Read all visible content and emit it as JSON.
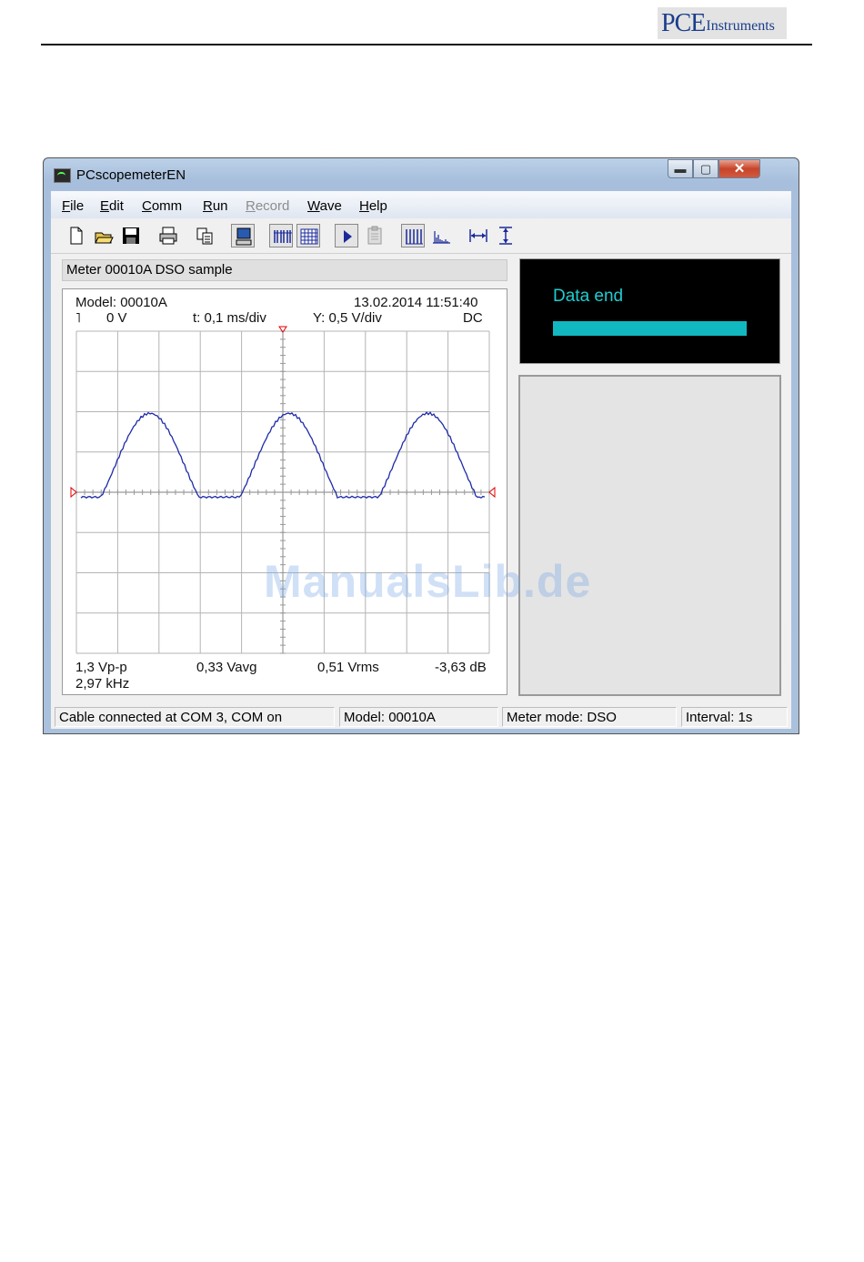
{
  "page_header": {
    "logo_mark": "PCE",
    "logo_text": "Instruments"
  },
  "window": {
    "title": "PCscopemeterEN",
    "controls": {
      "minimize": "▬",
      "maximize": "▢",
      "close": "✕"
    }
  },
  "menu": [
    {
      "label": "File",
      "accel": "F",
      "rest": "ile",
      "enabled": true
    },
    {
      "label": "Edit",
      "accel": "E",
      "rest": "dit",
      "enabled": true
    },
    {
      "label": "Comm",
      "accel": "C",
      "rest": "omm",
      "enabled": true
    },
    {
      "label": "Run",
      "accel": "R",
      "rest": "un",
      "enabled": true
    },
    {
      "label": "Record",
      "accel": "R",
      "rest": "ecord",
      "enabled": false
    },
    {
      "label": "Wave",
      "accel": "W",
      "rest": "ave",
      "enabled": true
    },
    {
      "label": "Help",
      "accel": "H",
      "rest": "elp",
      "enabled": true
    }
  ],
  "toolbar": [
    "new-icon",
    "open-icon",
    "save-icon",
    "print-icon",
    "copy-icon",
    "computer-icon",
    "bars-icon",
    "grid-icon",
    "play-icon",
    "clipboard-icon",
    "waveform-icon",
    "histogram-icon",
    "horizontal-measure-icon",
    "vertical-measure-icon"
  ],
  "scope": {
    "title_field": "Meter 00010A DSO sample",
    "model": "Model: 00010A",
    "datetime": "13.02.2014  11:51:40",
    "trigger_symbol": "˥",
    "trigger_level": "0 V",
    "timebase": "t:  0,1 ms/div",
    "vertical": "Y:  0,5 V/div",
    "coupling": "DC",
    "measurements": {
      "vpp": "1,3 Vp-p",
      "vavg": "0,33 Vavg",
      "vrms": "0,51 Vrms",
      "db": "-3,63 dB",
      "freq": "2,97 kHz"
    },
    "colors": {
      "trace": "#1e2aa8",
      "grid": "#b4b4b4",
      "marker": "#e00000"
    }
  },
  "status_panel": {
    "text": "Data end",
    "color": "#1ecdd2"
  },
  "statusbar": {
    "connection": "Cable connected at COM 3, COM on",
    "model": "Model: 00010A",
    "mode": "Meter mode: DSO",
    "interval": "Interval: 1s"
  },
  "watermark": "ManualsLib.de"
}
